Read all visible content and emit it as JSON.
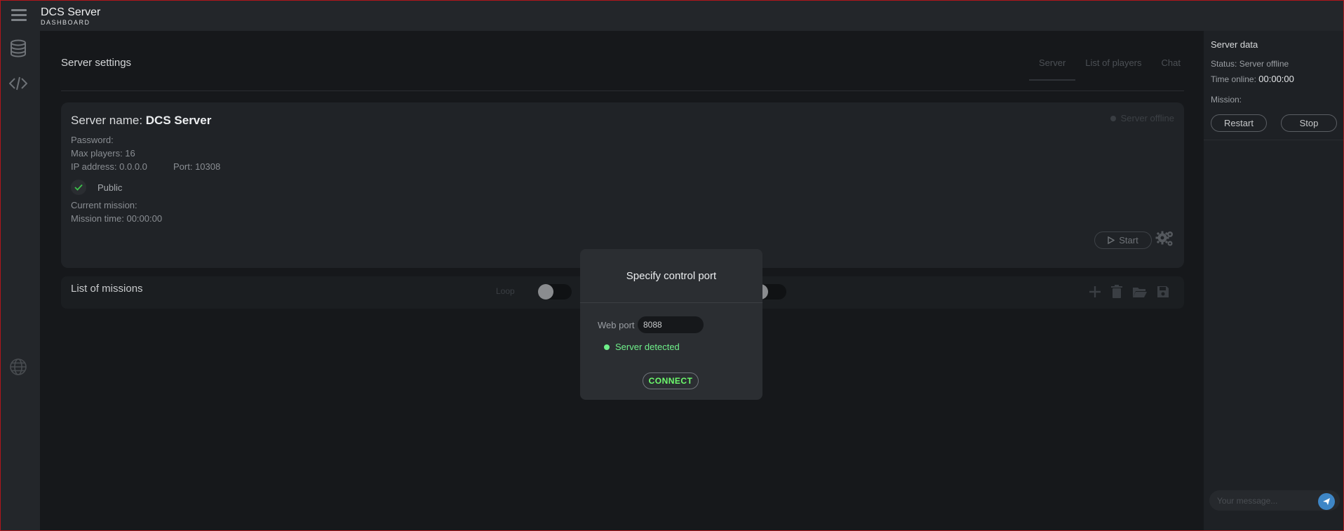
{
  "app": {
    "title": "DCS Server",
    "subtitle": "DASHBOARD"
  },
  "sidebar": {
    "icons": [
      "menu-icon",
      "database-icon",
      "code-icon",
      "globe-icon"
    ]
  },
  "main": {
    "page_title": "Server settings",
    "tabs": [
      {
        "label": "Server",
        "active": true
      },
      {
        "label": "List of players",
        "active": false
      },
      {
        "label": "Chat",
        "active": false
      }
    ],
    "server_card": {
      "name_label": "Server name:",
      "name_value": "DCS Server",
      "status": "Server offline",
      "password": "Password:",
      "max_players": "Max players: 16",
      "ip": "IP address: 0.0.0.0",
      "port": "Port: 10308",
      "public_label": "Public",
      "public_checked": true,
      "current_mission": "Current mission:",
      "mission_time": "Mission time: 00:00:00",
      "start_label": "Start"
    },
    "missions": {
      "title": "List of missions",
      "loop_label": "Loop"
    }
  },
  "right_panel": {
    "title": "Server data",
    "status": "Status: Server offline",
    "time_label": "Time online:",
    "time_value": "00:00:00",
    "mission_label": "Mission:",
    "restart_label": "Restart",
    "stop_label": "Stop",
    "message_placeholder": "Your message..."
  },
  "modal": {
    "title": "Specify control port",
    "port_label": "Web port",
    "port_value": "8088",
    "detected_text": "Server detected",
    "connect_label": "CONNECT"
  },
  "colors": {
    "accent_green": "#6ff08a",
    "connect_green": "#6dfc6d",
    "send_blue": "#3e86c6",
    "window_border": "#b0161c"
  }
}
